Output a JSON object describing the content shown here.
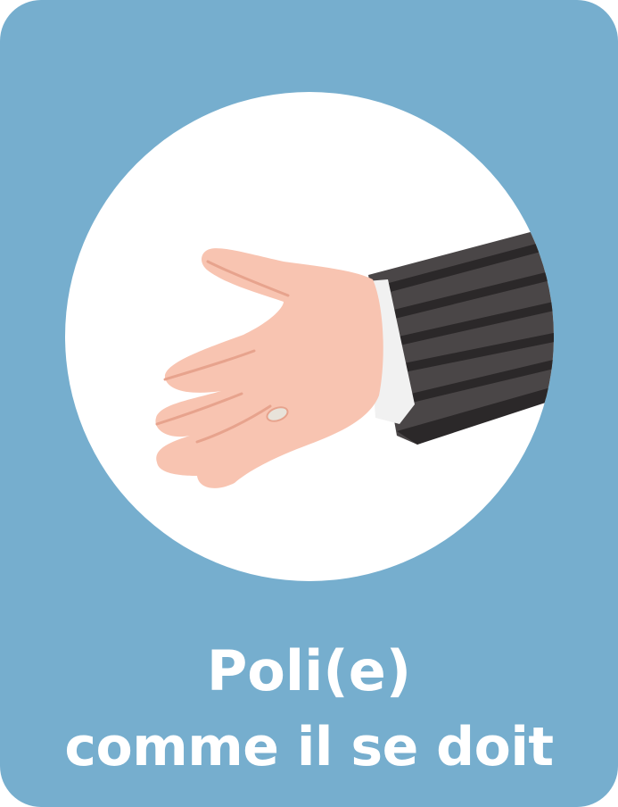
{
  "card": {
    "background_color": "#76aece",
    "circle_color": "#ffffff",
    "icon": "handshake-offer-hand"
  },
  "caption": {
    "line1": "Poli(e)",
    "line2": "comme il se doit"
  },
  "colors": {
    "skin": "#f8c4b1",
    "skin_shadow": "#e7a38d",
    "sleeve": "#4a4647",
    "sleeve_dark": "#2b2829",
    "cuff": "#f1f1f1",
    "ring": "#e8e3da"
  }
}
